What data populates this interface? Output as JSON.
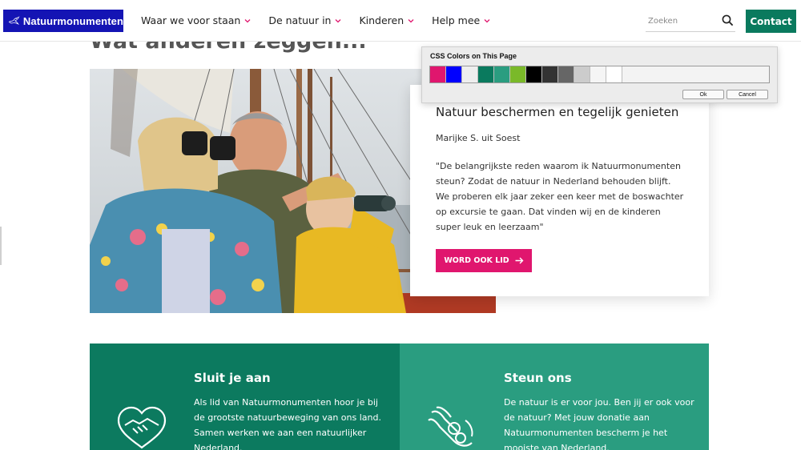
{
  "header": {
    "logo_text": "Natuurmonumenten",
    "nav": [
      {
        "label": "Waar we voor staan"
      },
      {
        "label": "De natuur in"
      },
      {
        "label": "Kinderen"
      },
      {
        "label": "Help mee"
      }
    ],
    "search_placeholder": "Zoeken",
    "contact_label": "Contact"
  },
  "section": {
    "heading": "Wat anderen zeggen..."
  },
  "quote": {
    "title": "Natuur beschermen en tegelijk genieten",
    "author": "Marijke S. uit Soest",
    "text": "\"De belangrijkste reden waarom ik Natuurmonumenten steun? Zodat de natuur in Nederland behouden blijft. We proberen elk jaar zeker een keer met de boswachter op excursie te gaan. Dat vinden wij en de kinderen super leuk en leerzaam\"",
    "button_label": "WORD OOK LID"
  },
  "popup": {
    "title": "CSS Colors on This Page",
    "swatches": [
      "#e0166e",
      "#0000ff",
      "#eeeeee",
      "#0a7a5e",
      "#2a9d80",
      "#7ab929",
      "#000000",
      "#333333",
      "#666666",
      "#cccccc",
      "#f5f5f5",
      "#ffffff"
    ],
    "ok_label": "Ok",
    "cancel_label": "Cancel"
  },
  "panels": {
    "left": {
      "title": "Sluit je aan",
      "text": "Als lid van Natuurmonumenten hoor je bij de grootste natuurbeweging van ons land. Samen werken we aan een natuurlijker Nederland."
    },
    "right": {
      "title": "Steun ons",
      "text": "De natuur is er voor jou. Ben jij er ook voor de natuur? Met jouw donatie aan Natuurmonumenten bescherm je het mooiste van Nederland."
    }
  },
  "colors": {
    "brand_blue": "#1414b4",
    "green_dark": "#0c7a5f",
    "green_light": "#2a9d80",
    "accent_pink": "#e0166e"
  },
  "icons": {
    "search": "search-icon",
    "chevron": "chevron-down-icon",
    "arrow": "arrow-right-icon",
    "handshake": "handshake-heart-icon",
    "hands": "helping-hands-icon"
  }
}
